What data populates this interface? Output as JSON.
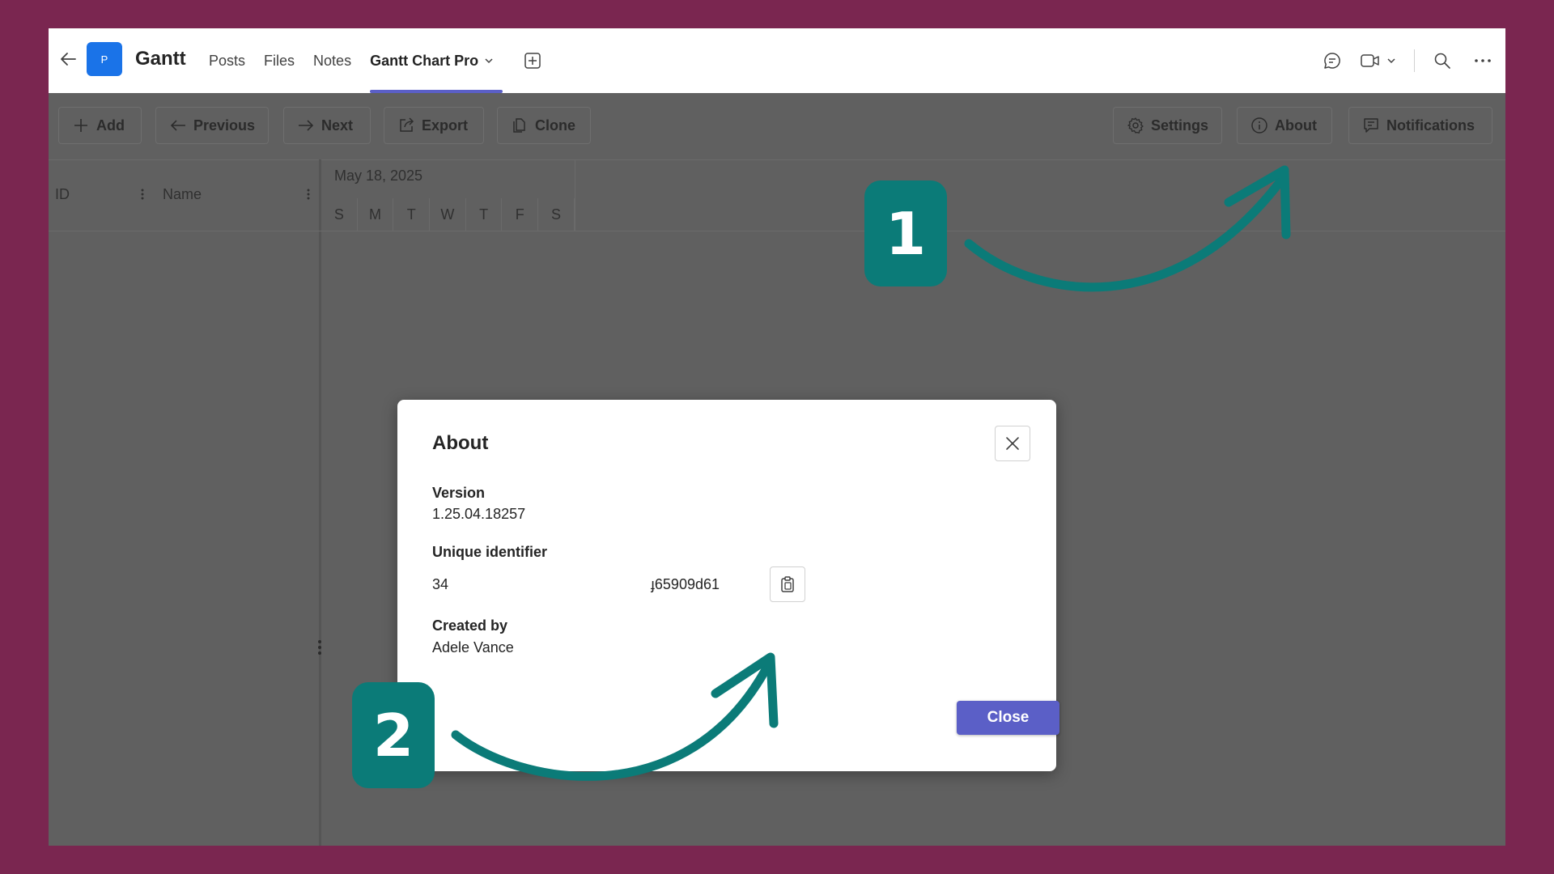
{
  "header": {
    "app_icon_letter": "P",
    "title": "Gantt",
    "tabs": [
      {
        "label": "Posts"
      },
      {
        "label": "Files"
      },
      {
        "label": "Notes"
      },
      {
        "label": "Gantt Chart Pro"
      }
    ],
    "active_tab_color": "#5b5fc7"
  },
  "toolbar": {
    "add": "Add",
    "previous": "Previous",
    "next": "Next",
    "export": "Export",
    "clone": "Clone",
    "settings": "Settings",
    "about": "About",
    "notifications": "Notifications"
  },
  "grid": {
    "col_id": "ID",
    "col_name": "Name",
    "date": "May 18, 2025",
    "days": [
      "S",
      "M",
      "T",
      "W",
      "T",
      "F",
      "S"
    ]
  },
  "modal": {
    "title": "About",
    "version_label": "Version",
    "version_value": "1.25.04.18257",
    "uid_label": "Unique identifier",
    "uid_start": "34",
    "uid_end": "ɟ65909d61",
    "created_by_label": "Created by",
    "created_by_value": "Adele Vance",
    "close_button": "Close"
  },
  "annotations": {
    "badge_1": "1",
    "badge_2": "2",
    "color": "#0b7b78"
  }
}
